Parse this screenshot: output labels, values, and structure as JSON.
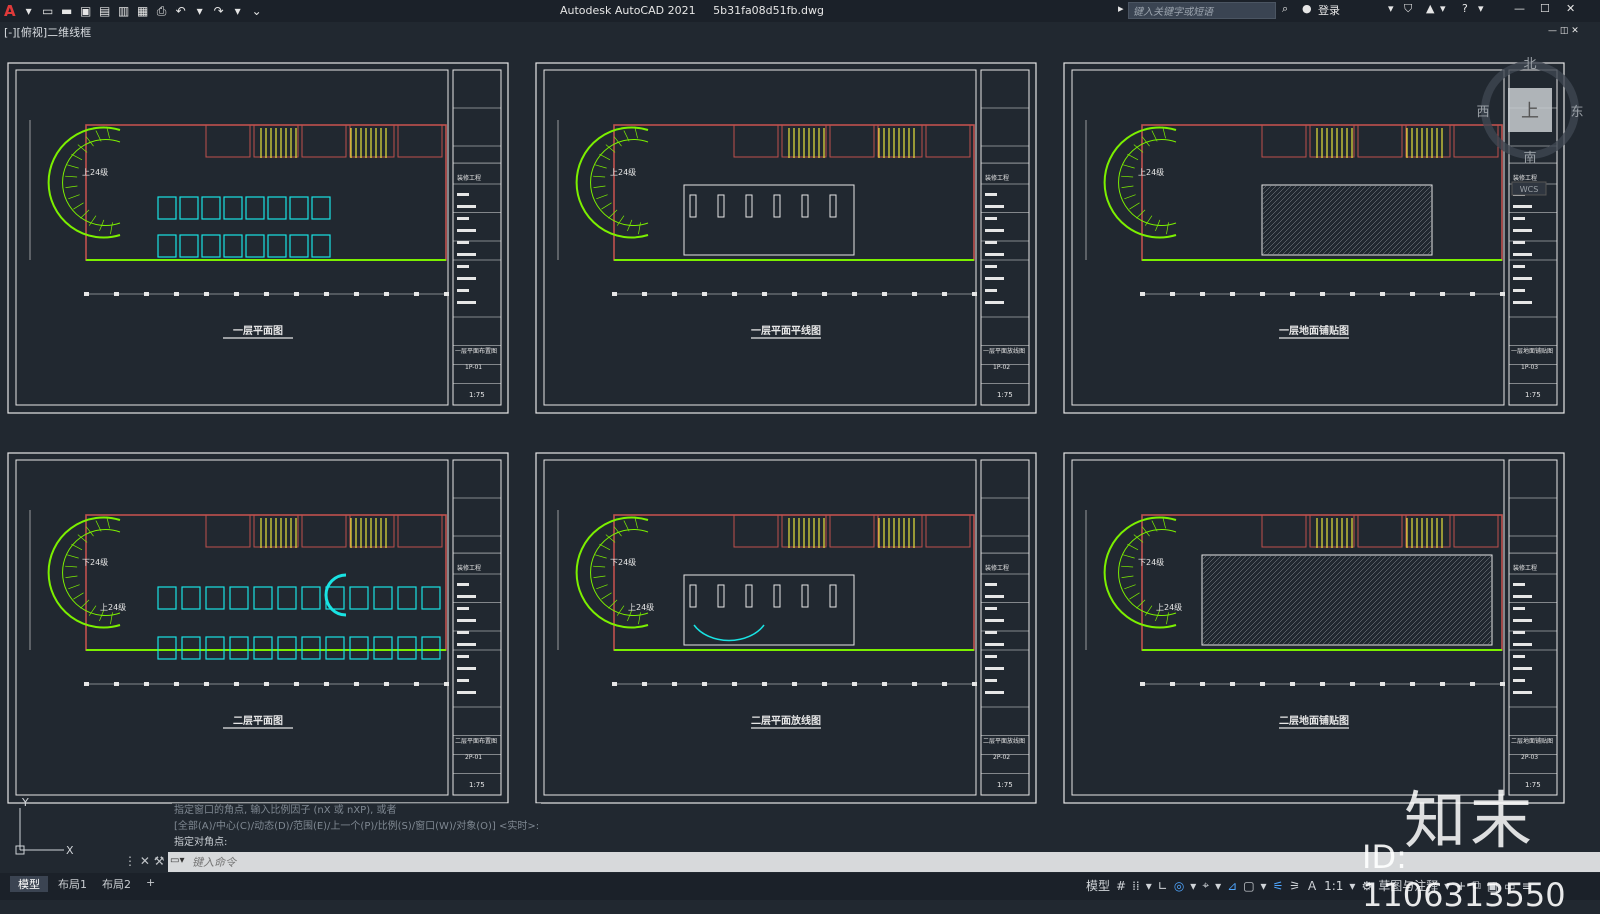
{
  "titlebar": {
    "app_name": "Autodesk AutoCAD 2021",
    "file_name": "5b31fa08d51fb.dwg",
    "search_placeholder": "键入关键字或短语",
    "login": "登录"
  },
  "viewport_label": "[-][俯视]二维线框",
  "viewcube": {
    "north": "北",
    "south": "南",
    "east": "东",
    "west": "西",
    "top": "上",
    "wcs": "WCS"
  },
  "sheets": [
    {
      "title": "一层平面图",
      "drawing_no": "1P-01",
      "scale": "1:75",
      "name_cn": "一层平面布置图"
    },
    {
      "title": "一层平面平线图",
      "drawing_no": "1P-02",
      "scale": "1:75",
      "name_cn": "一层平面放线图"
    },
    {
      "title": "一层地面铺贴图",
      "drawing_no": "1P-03",
      "scale": "1:75",
      "name_cn": "一层地面铺贴图"
    },
    {
      "title": "二层平面图",
      "drawing_no": "2P-01",
      "scale": "1:75",
      "name_cn": "二层平面布置图"
    },
    {
      "title": "二层平面放线图",
      "drawing_no": "2P-02",
      "scale": "1:75",
      "name_cn": "二层平面放线图"
    },
    {
      "title": "二层地面铺贴图",
      "drawing_no": "2P-03",
      "scale": "1:75",
      "name_cn": "二层地面铺贴图"
    }
  ],
  "sheet_labels": {
    "project_label": "装修工程",
    "stair_up_1": "上24级",
    "stair_down_2": "下24级",
    "stair_up_2": "上24级"
  },
  "command": {
    "history": [
      "指定窗口的角点, 输入比例因子 (nX 或 nXP), 或者",
      "[全部(A)/中心(C)/动态(D)/范围(E)/上一个(P)/比例(S)/窗口(W)/对象(O)] <实时>:",
      "指定对角点:"
    ],
    "placeholder": "键入命令"
  },
  "layout_tabs": [
    "模型",
    "布局1",
    "布局2",
    "+"
  ],
  "status": {
    "model": "模型",
    "scale": "1:1",
    "workspace": "草图与注释"
  },
  "watermark": {
    "brand": "知末",
    "id": "ID: 1106313550"
  },
  "colors": {
    "background": "#212830",
    "frame": "#e6e6e6",
    "walls": "#c0504d",
    "furniture": "#19e3e3",
    "stairs": "#7cf000",
    "hatch": "#e8e23a"
  }
}
